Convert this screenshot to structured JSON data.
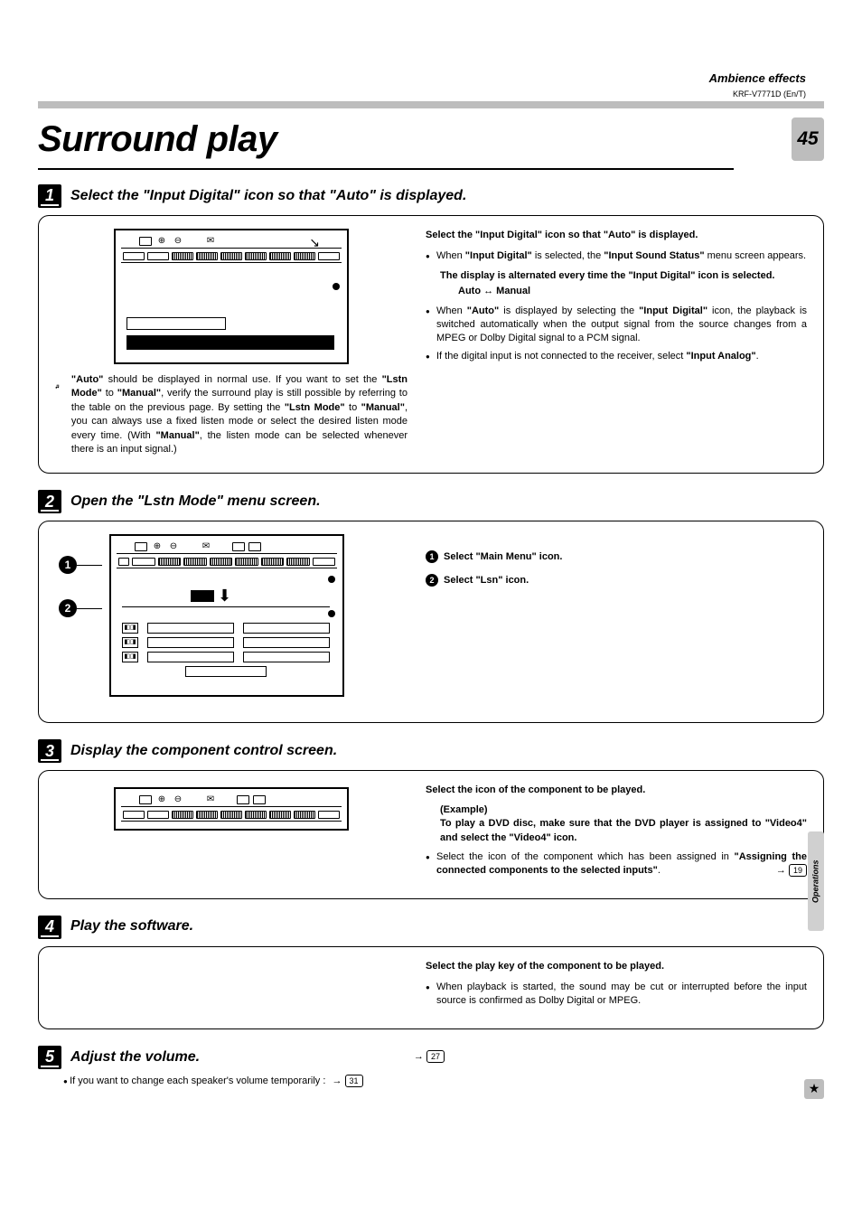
{
  "header": {
    "section_name": "Ambience effects",
    "model": "KRF-V7771D (En/T)",
    "page_number": "45"
  },
  "page_title": "Surround play",
  "steps": {
    "s1": {
      "num": "1",
      "title": "Select the \"Input Digital\" icon so that \"Auto\" is displayed.",
      "left_note": "\"Auto\" should be displayed in normal use. If you want to set the \"Lstn Mode\" to \"Manual\", verify the surround play is still possible by referring to the table on the previous page. By setting the \"Lstn Mode\" to \"Manual\", you can always use a fixed listen mode or select the desired listen mode every time. (With \"Manual\", the listen mode can be selected whenever there is an input signal.)",
      "r_heading": "Select the \"Input Digital\" icon so that \"Auto\" is displayed.",
      "r_b1_pre": "When ",
      "r_b1_bold1": "\"Input Digital\"",
      "r_b1_mid": " is selected, the ",
      "r_b1_bold2": "\"Input Sound Status\"",
      "r_b1_post": " menu screen appears.",
      "r_block_bold": "The display is alternated every time the \"Input Digital\" icon is selected.",
      "r_auto": "Auto",
      "r_manual": "Manual",
      "r_b2_pre": "When ",
      "r_b2_bold1": "\"Auto\"",
      "r_b2_mid": " is displayed by selecting the ",
      "r_b2_bold2": "\"Input Digital\"",
      "r_b2_post": " icon, the playback is switched automatically when the output signal from the source changes from a MPEG or Dolby Digital signal to a PCM signal.",
      "r_b3_pre": "If the digital input is not connected to the receiver, select ",
      "r_b3_bold": "\"Input Analog\"",
      "r_b3_post": "."
    },
    "s2": {
      "num": "2",
      "title": "Open the \"Lstn Mode\" menu screen.",
      "r1_label": "Select \"Main Menu\" icon.",
      "r2_label": "Select \"Lsn\" icon."
    },
    "s3": {
      "num": "3",
      "title": "Display the component control screen.",
      "r_heading": "Select the icon of the component to be played.",
      "r_example_label": "(Example)",
      "r_example_text": "To play a DVD disc, make sure that the DVD player is assigned to \"Video4\" and select the \"Video4\" icon.",
      "r_b_pre": "Select the icon of the component which has been assigned in ",
      "r_b_bold": "\"Assigning the connected components to the selected inputs\"",
      "r_b_post": ".",
      "pageref": "19"
    },
    "s4": {
      "num": "4",
      "title": "Play the software.",
      "r_heading": "Select the play key of the component to be played.",
      "r_bullet": "When playback is started, the sound may be cut or interrupted before the input source is confirmed as Dolby Digital or MPEG."
    },
    "s5": {
      "num": "5",
      "title": "Adjust the volume.",
      "pageref": "27",
      "sub": "If you want to change each speaker's volume temporarily :",
      "subref": "31"
    }
  },
  "side_tab": "Operations"
}
